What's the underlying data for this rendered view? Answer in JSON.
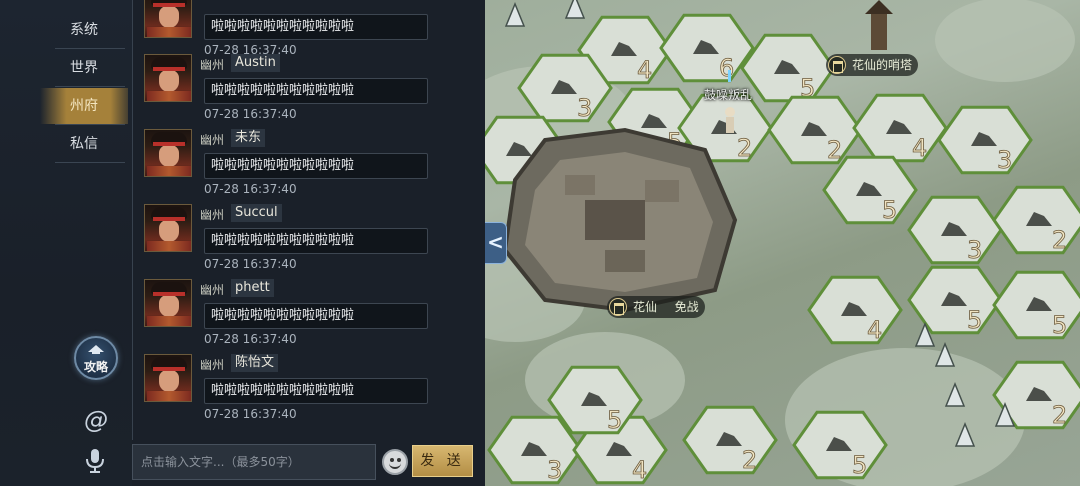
{
  "tabs": [
    {
      "key": "system",
      "label": "系统"
    },
    {
      "key": "world",
      "label": "世界"
    },
    {
      "key": "prefecture",
      "label": "州府"
    },
    {
      "key": "private",
      "label": "私信"
    }
  ],
  "active_tab": "州府",
  "sidebar": {
    "guide_label": "攻略",
    "at_symbol": "@"
  },
  "messages": [
    {
      "region": "",
      "name": "",
      "text": "啦啦啦啦啦啦啦啦啦啦啦",
      "time": "07-28 16:37:40"
    },
    {
      "region": "幽州",
      "name": "Austin",
      "text": "啦啦啦啦啦啦啦啦啦啦啦",
      "time": "07-28 16:37:40"
    },
    {
      "region": "幽州",
      "name": "未东",
      "text": "啦啦啦啦啦啦啦啦啦啦啦",
      "time": "07-28 16:37:40"
    },
    {
      "region": "幽州",
      "name": "Succul",
      "text": "啦啦啦啦啦啦啦啦啦啦啦",
      "time": "07-28 16:37:40"
    },
    {
      "region": "幽州",
      "name": "phett",
      "text": "啦啦啦啦啦啦啦啦啦啦啦",
      "time": "07-28 16:37:40"
    },
    {
      "region": "幽州",
      "name": "陈怡文",
      "text": "啦啦啦啦啦啦啦啦啦啦啦",
      "time": "07-28 16:37:40"
    }
  ],
  "input": {
    "placeholder": "点击输入文字...（最多50字）",
    "value": ""
  },
  "send_label": "发 送",
  "map": {
    "collapse_glyph": "<",
    "labels": {
      "watchtower": "花仙的哨塔",
      "city_owner": "花仙",
      "city_status": "免战",
      "rebels": "鼓噪叛乱"
    },
    "tile_levels": [
      "4",
      "6",
      "5",
      "3",
      "2",
      "5",
      "2",
      "2",
      "4",
      "3",
      "5",
      "3",
      "2",
      "4",
      "5",
      "5",
      "3",
      "4",
      "2",
      "5",
      "5",
      "2"
    ],
    "colors": {
      "tile_fill": "#d9dfd6",
      "tile_border": "#5f8f3a",
      "ground": "#a3b09f",
      "level_number": "#f1e4c2"
    }
  }
}
